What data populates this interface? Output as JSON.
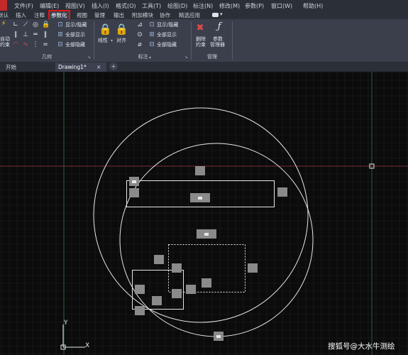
{
  "menu": {
    "items": [
      "文件(F)",
      "编辑(E)",
      "视图(V)",
      "插入(I)",
      "格式(O)",
      "工具(T)",
      "绘图(D)",
      "标注(N)",
      "修改(M)",
      "参数(P)",
      "窗口(W)",
      "帮助(H)"
    ]
  },
  "ribbon_tabs": {
    "items": [
      "默认",
      "插入",
      "注释",
      "参数化",
      "视图",
      "管理",
      "输出",
      "附加模块",
      "协作",
      "精选应用"
    ],
    "active": "参数化"
  },
  "ribbon": {
    "geometry": {
      "title": "几何",
      "left_labels": [
        "自动",
        "约束"
      ],
      "show_hide": "显示/隐藏",
      "show_all": "全部显示",
      "hide_all": "全部隐藏"
    },
    "dimensional": {
      "title": "标注",
      "linear": "线性",
      "aligned": "对齐",
      "show_hide": "显示/隐藏",
      "show_all": "全部显示",
      "hide_all": "全部隐藏"
    },
    "manage": {
      "title": "管理",
      "delete_constraints": [
        "删除",
        "约束"
      ],
      "param_manager": [
        "参数",
        "管理器"
      ]
    }
  },
  "doc_tabs": {
    "start": "开始",
    "drawing": "Drawing1*",
    "close": "×",
    "add": "+"
  },
  "canvas": {
    "ucs_y": "Y",
    "ucs_x": "X",
    "background": "#0b0b0b",
    "grid_color": "#1e2026",
    "axis_x_color": "#7a2e3a",
    "axis_y_color": "#2e5e3a",
    "geometry_color": "#e6e6e6",
    "marker_color": "#8a8a8a"
  },
  "watermark": "搜狐号@大水牛测绘"
}
